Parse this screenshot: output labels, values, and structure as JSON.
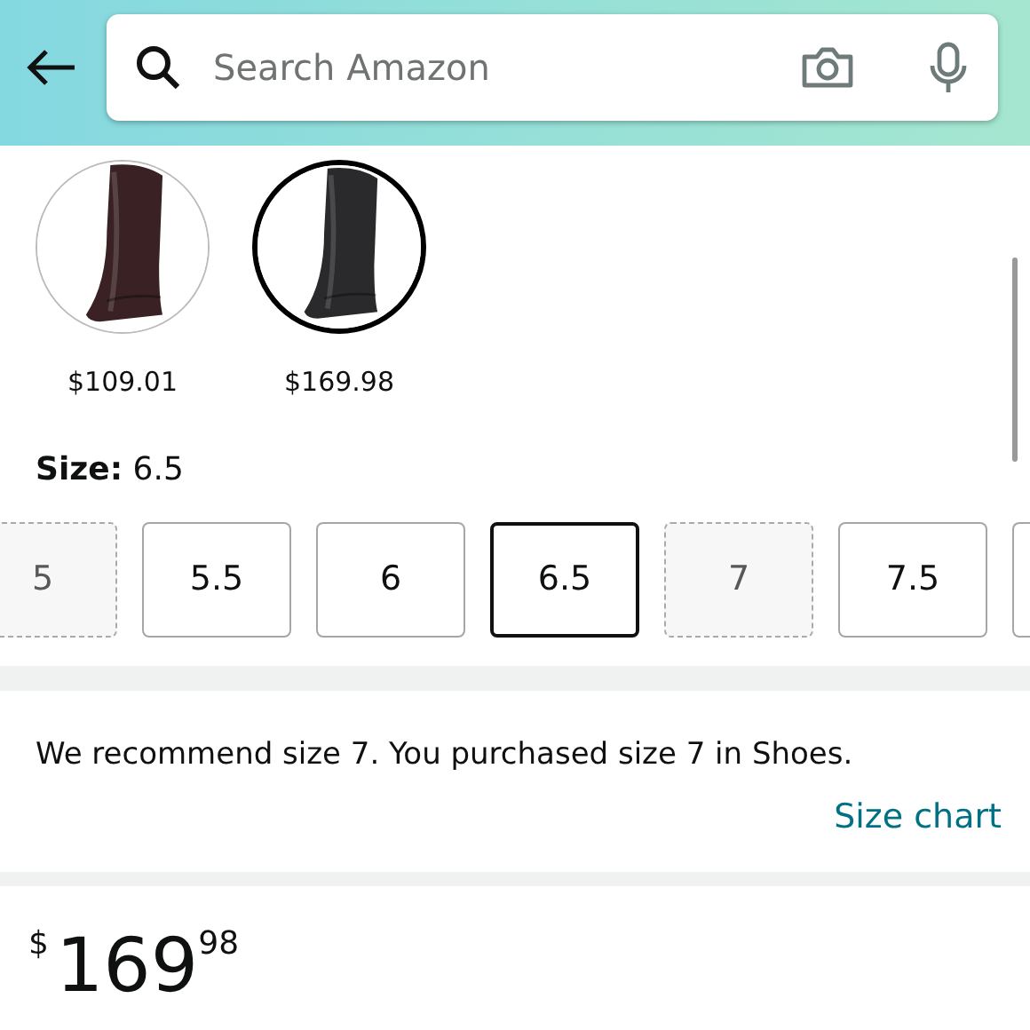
{
  "search": {
    "placeholder": "Search Amazon"
  },
  "swatches": [
    {
      "price": "$109.01",
      "selected": false,
      "color": "#3a2224"
    },
    {
      "price": "$169.98",
      "selected": true,
      "color": "#2a2a2c"
    }
  ],
  "size_label": "Size:",
  "size_value": "6.5",
  "sizes": [
    {
      "label": "5",
      "available": false,
      "selected": false
    },
    {
      "label": "5.5",
      "available": true,
      "selected": false
    },
    {
      "label": "6",
      "available": true,
      "selected": false
    },
    {
      "label": "6.5",
      "available": true,
      "selected": true
    },
    {
      "label": "7",
      "available": false,
      "selected": false
    },
    {
      "label": "7.5",
      "available": true,
      "selected": false
    }
  ],
  "recommendation": "We recommend size 7. You purchased size 7 in Shoes.",
  "size_chart_link": "Size chart",
  "price": {
    "currency": "$",
    "whole": "169",
    "fraction": "98"
  }
}
